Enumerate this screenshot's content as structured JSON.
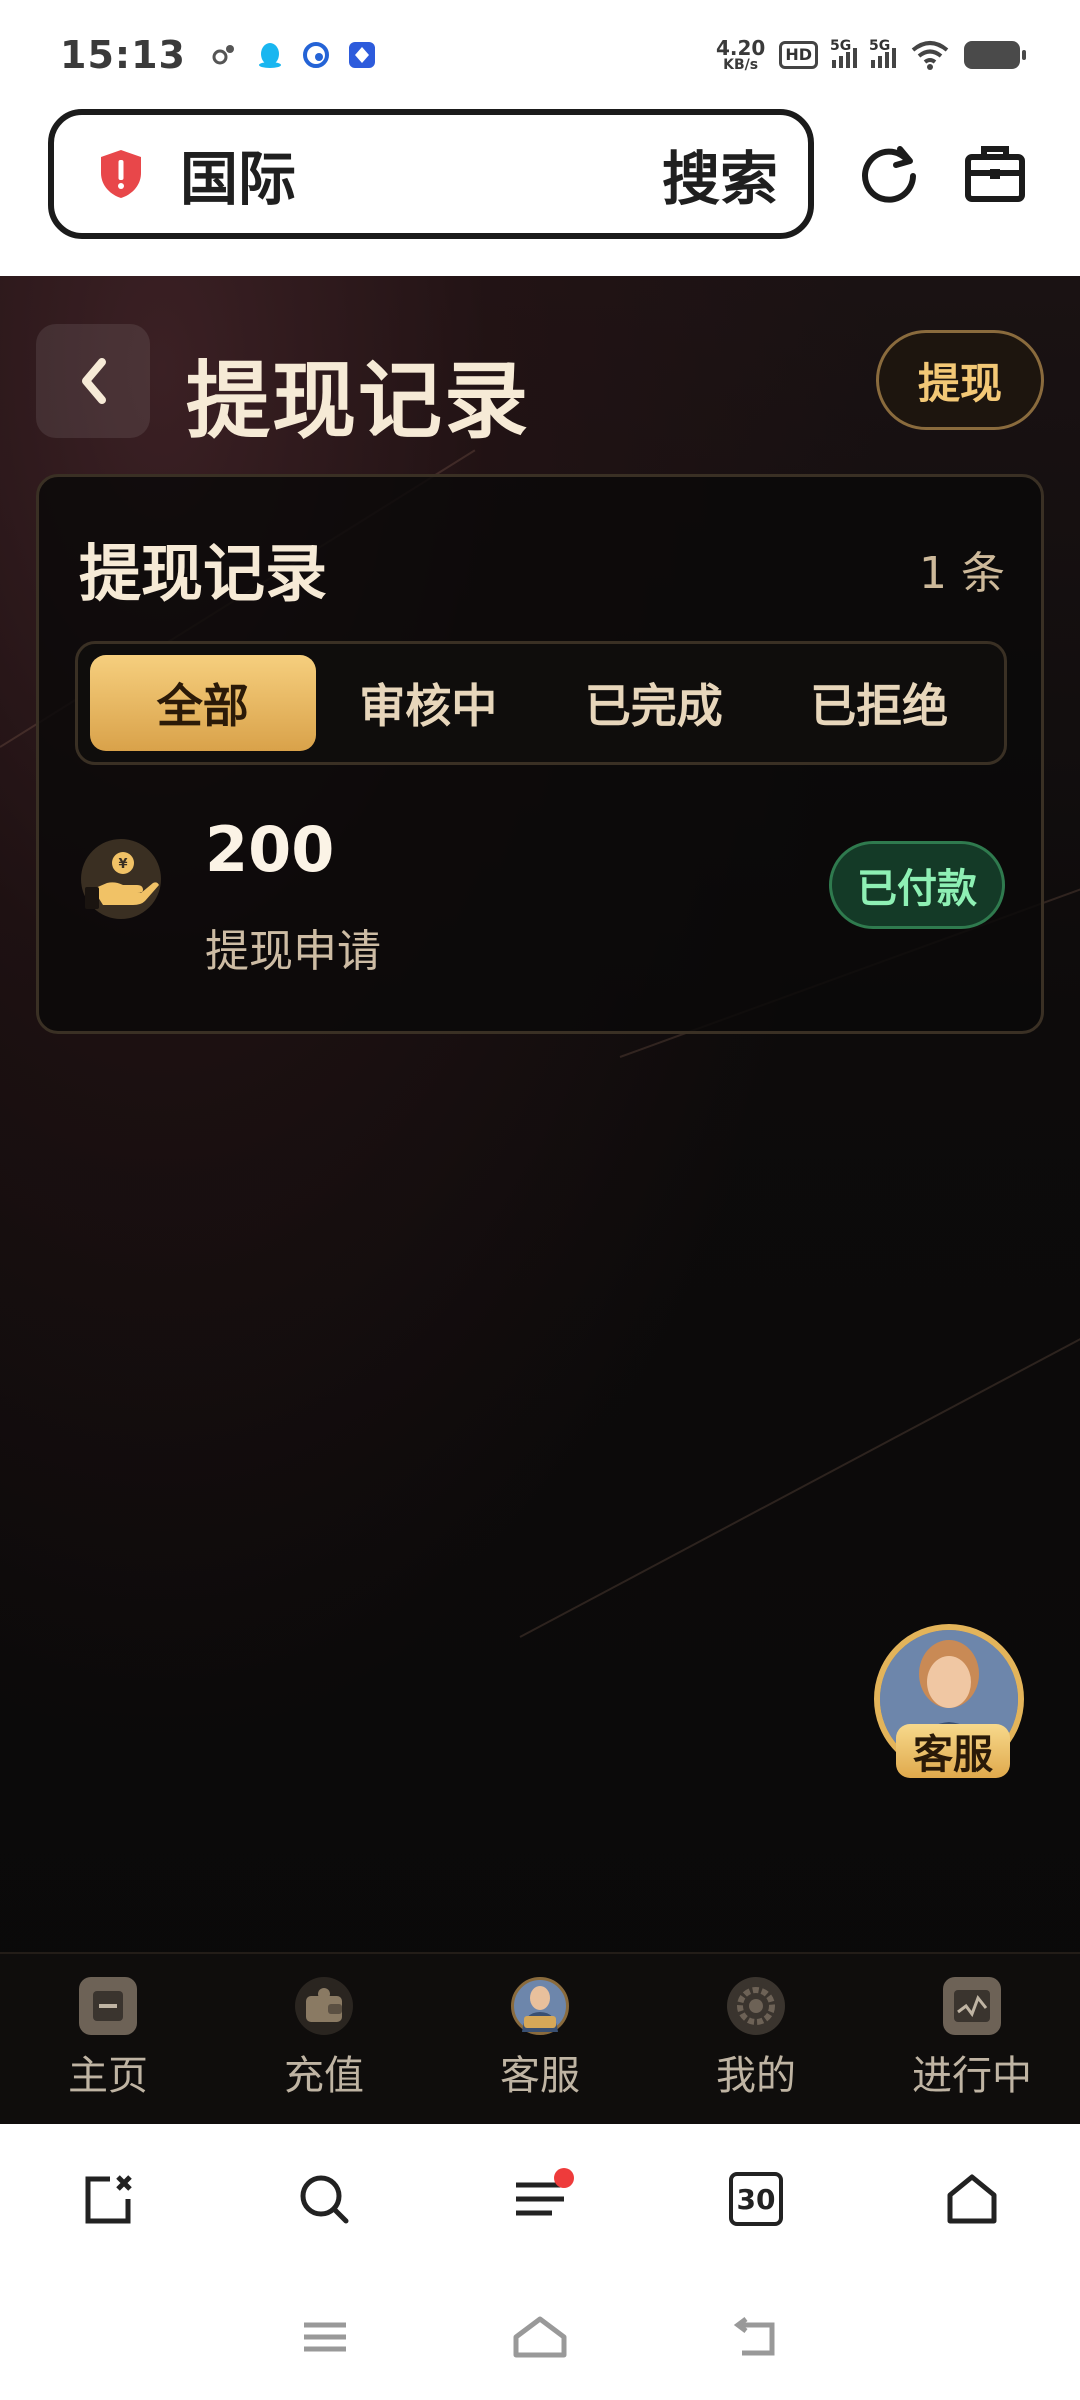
{
  "status_bar": {
    "time": "15:13",
    "net_speed_value": "4.20",
    "net_speed_unit": "KB/s",
    "hd_label": "HD",
    "sim1_label": "5G",
    "sim2_label": "5G"
  },
  "browser": {
    "url_text": "国际",
    "search_label": "搜索"
  },
  "page": {
    "title": "提现记录",
    "withdraw_button": "提现"
  },
  "card": {
    "title": "提现记录",
    "count": "1 条",
    "tabs": [
      {
        "label": "全部",
        "active": true
      },
      {
        "label": "审核中",
        "active": false
      },
      {
        "label": "已完成",
        "active": false
      },
      {
        "label": "已拒绝",
        "active": false
      }
    ],
    "records": [
      {
        "amount": "200",
        "description": "提现申请",
        "status": "已付款",
        "status_color": "#8ef0b4"
      }
    ]
  },
  "floating_service": {
    "label": "客服"
  },
  "app_nav": {
    "items": [
      {
        "label": "主页",
        "icon": "home-icon"
      },
      {
        "label": "充值",
        "icon": "wallet-icon"
      },
      {
        "label": "客服",
        "icon": "customer-service-icon"
      },
      {
        "label": "我的",
        "icon": "gear-icon"
      },
      {
        "label": "进行中",
        "icon": "chart-icon"
      }
    ]
  },
  "browser_toolbar": {
    "tab_count": "30"
  },
  "colors": {
    "accent_gold": "#f3c876",
    "paid_green": "#8ef0b4",
    "background_dark": "#0a0909"
  }
}
